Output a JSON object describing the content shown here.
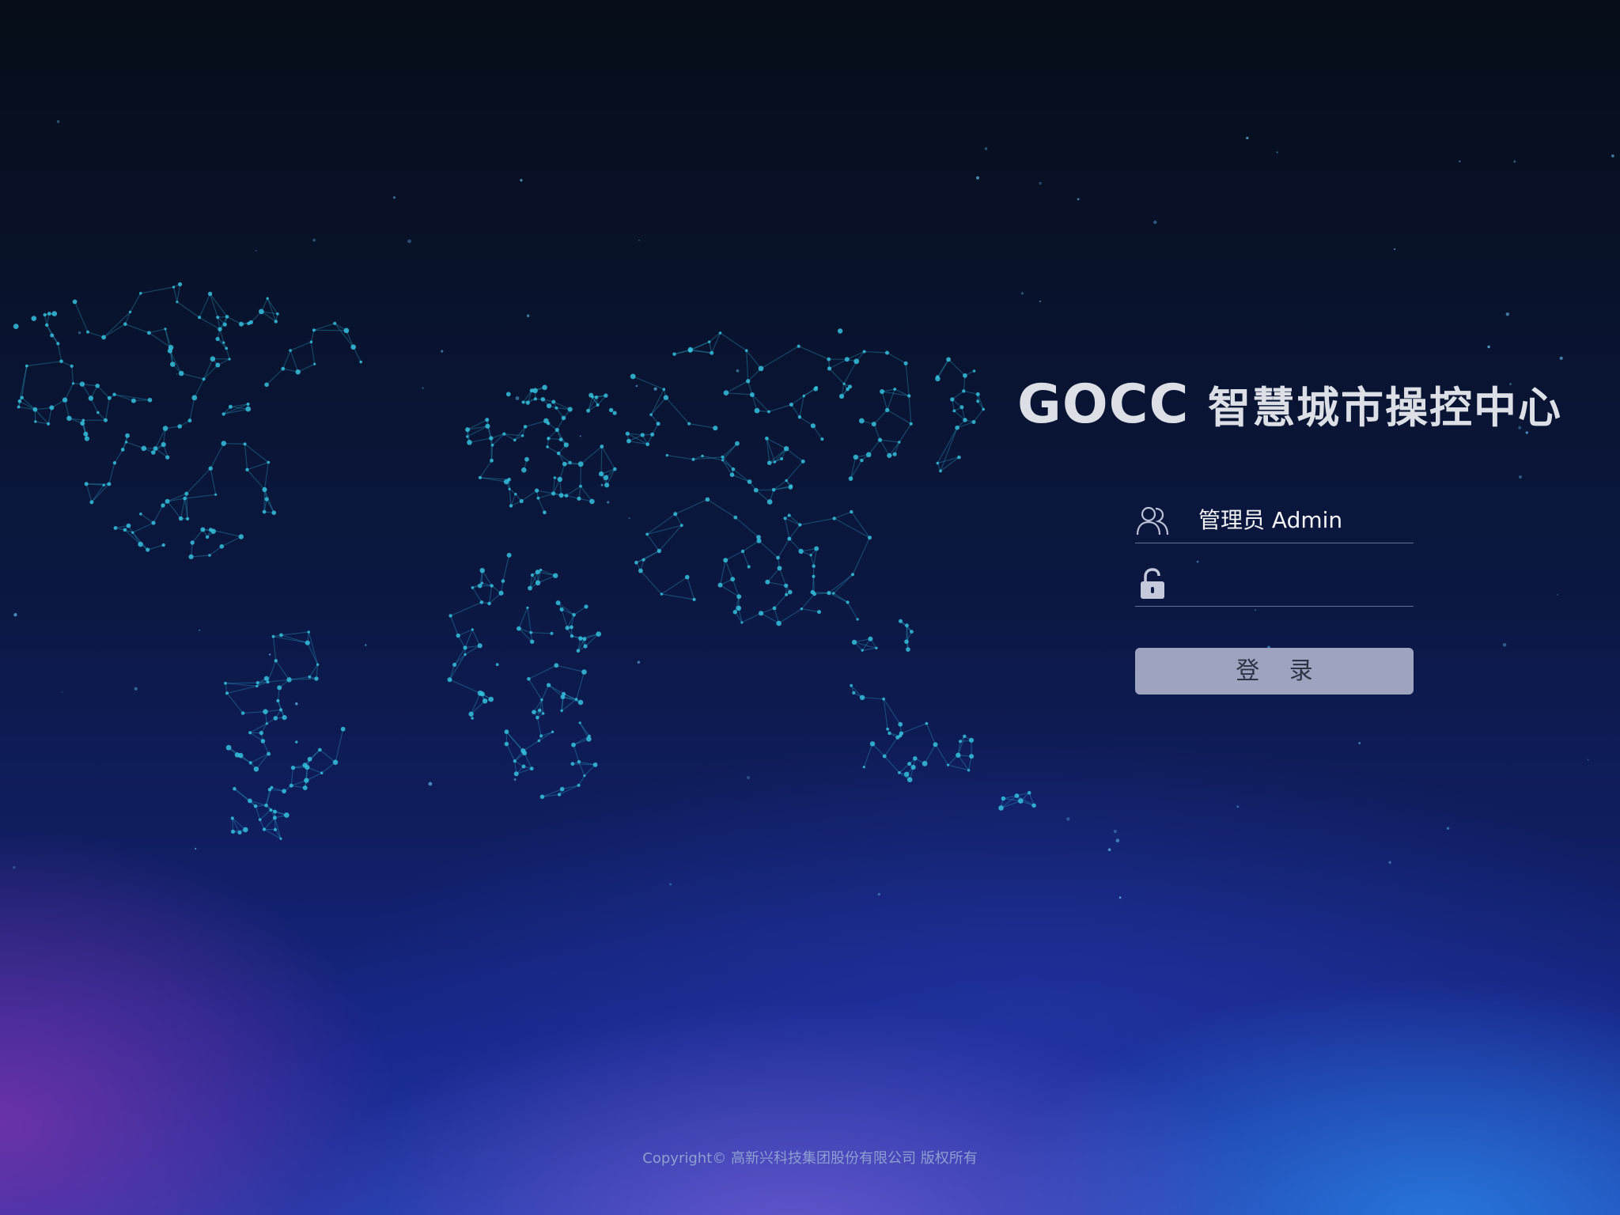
{
  "app": {
    "brand": "GOCC",
    "subtitle": "智慧城市操控中心"
  },
  "login": {
    "username_value": "管理员 Admin",
    "password_value": "",
    "submit_label": "登 录"
  },
  "icons": {
    "user": "user-icon",
    "password": "lock-icon"
  },
  "footer": {
    "copyright": "Copyright©  高新兴科技集团股份有限公司 版权所有"
  },
  "colors": {
    "button_bg": "#9ea3bf",
    "map_lines": "#2aa7c8",
    "title": "#dcdfe6"
  }
}
